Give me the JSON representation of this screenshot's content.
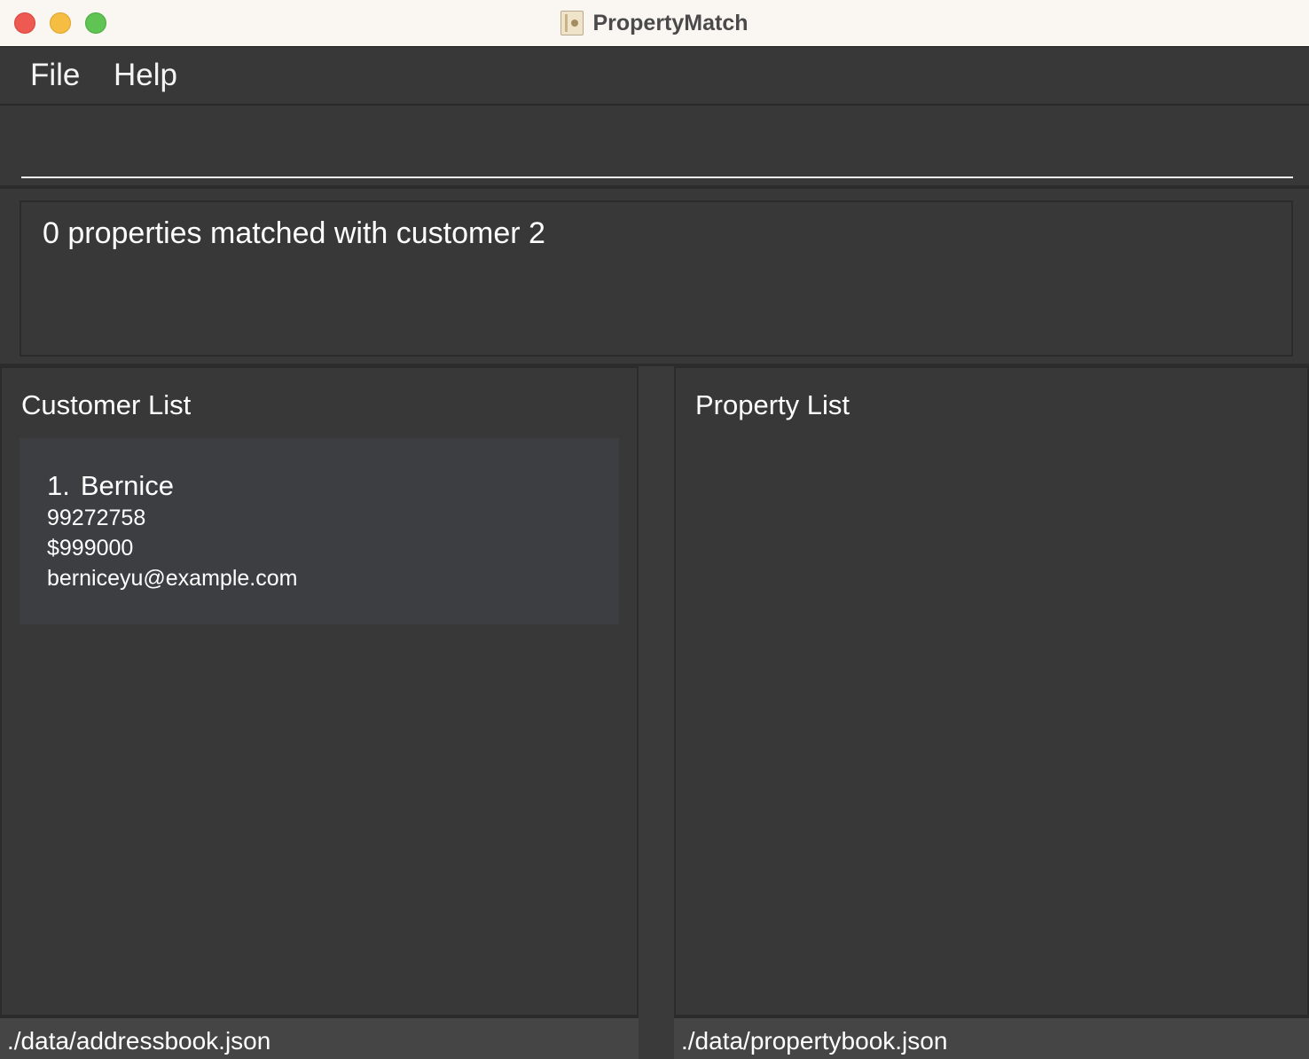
{
  "window": {
    "title": "PropertyMatch",
    "icon": "address-book-icon"
  },
  "menu": {
    "file_label": "File",
    "help_label": "Help"
  },
  "command": {
    "value": "",
    "placeholder": ""
  },
  "result": {
    "message": "0 properties matched with customer 2"
  },
  "customer_panel": {
    "heading": "Customer List",
    "customers": [
      {
        "index": "1.",
        "name": "Bernice",
        "phone": "99272758",
        "budget": "$999000",
        "email": "berniceyu@example.com"
      }
    ]
  },
  "property_panel": {
    "heading": "Property List",
    "properties": []
  },
  "status": {
    "customer_file": "./data/addressbook.json",
    "property_file": "./data/propertybook.json"
  },
  "colors": {
    "background": "#383838",
    "card": "#3d3e42",
    "titlebar": "#faf6f2",
    "statusbar": "#454545",
    "close": "#ee5a52",
    "minimize": "#f5bd41",
    "maximize": "#5fc454"
  }
}
